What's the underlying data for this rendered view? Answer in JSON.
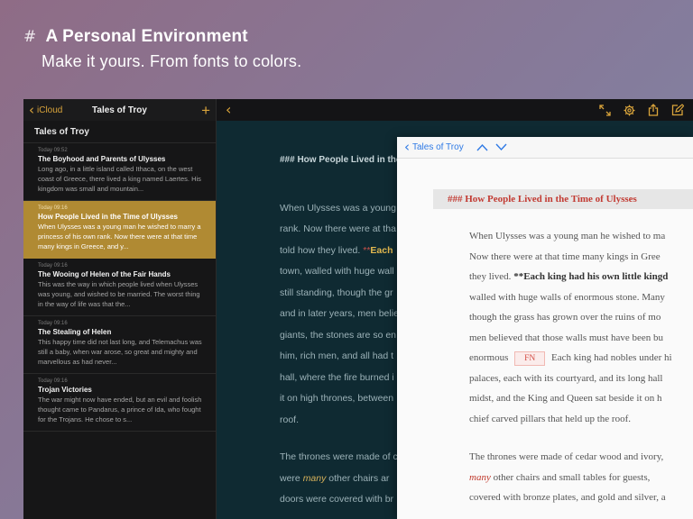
{
  "hero": {
    "hash": "#",
    "title": "A Personal Environment",
    "subtitle": "Make it yours. From fonts to colors."
  },
  "sidebar": {
    "back_label": "iCloud",
    "title": "Tales of Troy",
    "add": "+",
    "header": "Tales of Troy",
    "notes": [
      {
        "date": "Today 09:52",
        "title": "The Boyhood and Parents of Ulysses",
        "body": "Long ago, in a little island called Ithaca, on the west coast of Greece, there lived a king named Laertes. His kingdom was small and mountain..."
      },
      {
        "date": "Today 09:16",
        "title": "How People Lived in the Time of Ulysses",
        "body": "When Ulysses was a young man he wished to marry a princess of his own rank. Now there were at that time many kings in Greece, and y..."
      },
      {
        "date": "Today 09:16",
        "title": "The Wooing of Helen of the Fair Hands",
        "body": "This was the way in which people lived when Ulysses was young, and wished to be married. The worst thing in the way of life was that the..."
      },
      {
        "date": "Today 09:16",
        "title": "The Stealing of Helen",
        "body": "This happy time did not last long, and Telemachus was still a baby, when war arose, so great and mighty and marvellous as had never..."
      },
      {
        "date": "Today 09:16",
        "title": "Trojan Victories",
        "body": "The war might now have ended, but an evil and foolish thought came to Pandarus, a prince of Ida, who fought for the Trojans. He chose to s..."
      }
    ]
  },
  "editor": {
    "heading": "### How People Lived in the Tim",
    "p1": [
      "When Ulysses was a young",
      "rank. Now there were at tha",
      "told how they lived.",
      "town, walled with huge wall",
      "still standing, though the gr",
      "and in later years, men belie",
      "giants, the stones are so en",
      "him, rich men, and all had t",
      "hall, where the fire burned i",
      "it on high thrones, between",
      "roof."
    ],
    "hl_marks": "**",
    "hl_word": "Each",
    "p2": [
      "The thrones were made of c",
      "doors were covered with br"
    ],
    "p2_pre": "were",
    "p2_em": "many",
    "p2_post": "other chairs ar"
  },
  "preview": {
    "back_label": "Tales of Troy",
    "heading": "### How People Lived in the Time of Ulysses",
    "lines": [
      "When Ulysses was a young man he wished to ma",
      "Now there were at that time many kings in Gree",
      "walled with huge walls of enormous stone. Many",
      "though the grass has grown over the ruins of mo",
      "men believed that those walls must have been bu",
      "palaces, each with its courtyard, and its long hall",
      "midst, and the King and Queen sat beside it on h",
      "chief carved pillars that held up the roof."
    ],
    "line3_pre": "they lived.",
    "line3_bold": "**Each king had his own little kingd",
    "line7_pre": "enormous",
    "fn_label": "FN",
    "line7_post": "Each king had nobles under hi",
    "p2_line1": "The thrones were made of cedar wood and ivory,",
    "p2_em": "many",
    "p2_line2_post": "other chairs and small tables for guests,",
    "p2_line3": "covered with bronze plates, and gold and silver, a"
  },
  "colors": {
    "accent": "#d9a43b",
    "selected_note": "#b08a33",
    "editor_bg": "#0f2a32",
    "preview_link": "#2f7ae5",
    "preview_heading": "#c23b33"
  }
}
